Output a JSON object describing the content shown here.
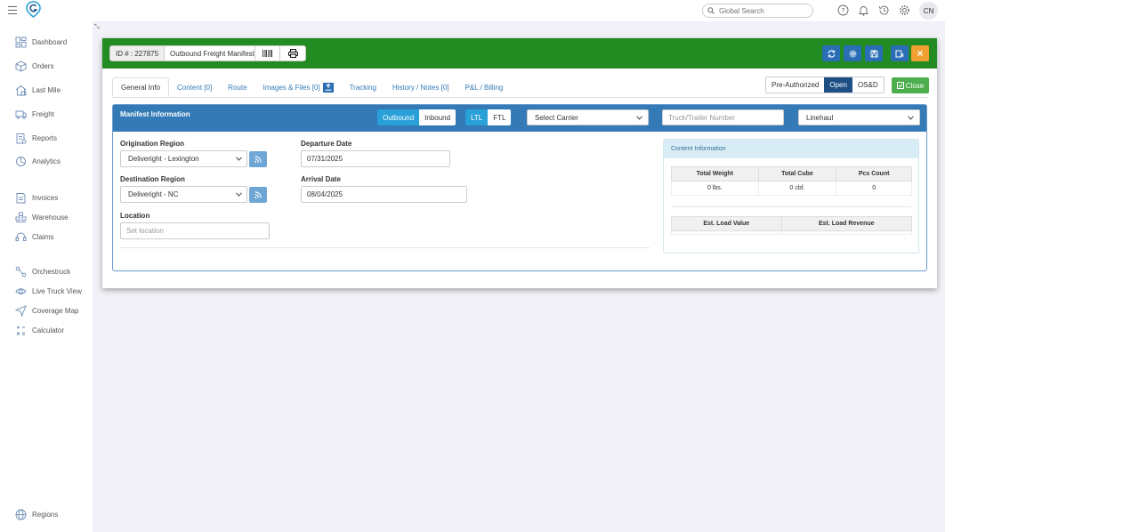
{
  "app": {
    "user_initials": "CN"
  },
  "search": {
    "placeholder": "Global Search"
  },
  "sidebar": {
    "items": [
      {
        "label": "Dashboard"
      },
      {
        "label": "Orders"
      },
      {
        "label": "Last Mile"
      },
      {
        "label": "Freight"
      },
      {
        "label": "Reports"
      },
      {
        "label": "Analytics"
      },
      {
        "label": "Invoices"
      },
      {
        "label": "Warehouse"
      },
      {
        "label": "Claims"
      },
      {
        "label": "Orchestruck"
      },
      {
        "label": "Live Truck View"
      },
      {
        "label": "Coverage Map"
      },
      {
        "label": "Calculator"
      }
    ],
    "footer_label": "Regions"
  },
  "modal": {
    "id_label": "ID # : 227875",
    "title_value": "Outbound Freight Manifest",
    "colors": {
      "header": "#228b22",
      "primary": "#337ab7",
      "action": "#2a6eb5",
      "close_x": "#f0a030",
      "success": "#4cae4c"
    },
    "tabs": [
      {
        "label": "General Info"
      },
      {
        "label": "Content [0]"
      },
      {
        "label": "Route"
      },
      {
        "label": "Images & Files [0]"
      },
      {
        "label": "Tracking"
      },
      {
        "label": "History / Notes [0]"
      },
      {
        "label": "P&L / Billing"
      }
    ],
    "status_options": [
      "Pre-Authorized",
      "Open",
      "OS&D"
    ],
    "status_selected": "Open",
    "close_label": "Close"
  },
  "manifest": {
    "title": "Manifest Information",
    "direction_options": [
      "Outbound",
      "Inbound"
    ],
    "direction_selected": "Outbound",
    "load_options": [
      "LTL",
      "FTL"
    ],
    "load_selected": "LTL",
    "carrier": "Select Carrier",
    "truck_placeholder": "Truck/Trailer Number",
    "linehaul": "Linehaul",
    "origination_label": "Origination Region",
    "origination_value": "Deliveright - Lexington",
    "destination_label": "Destination Region",
    "destination_value": "Deliveright - NC",
    "location_label": "Location",
    "location_placeholder": "Set location",
    "departure_label": "Departure Date",
    "departure_value": "07/31/2025",
    "arrival_label": "Arrival Date",
    "arrival_value": "08/04/2025"
  },
  "content_info": {
    "title": "Content Information",
    "headers": [
      "Total Weight",
      "Total Cube",
      "Pcs Count"
    ],
    "values": [
      "0 lbs.",
      "0 cbf.",
      "0"
    ],
    "est_headers": [
      "Est. Load Value",
      "Est. Load Revenue"
    ]
  }
}
